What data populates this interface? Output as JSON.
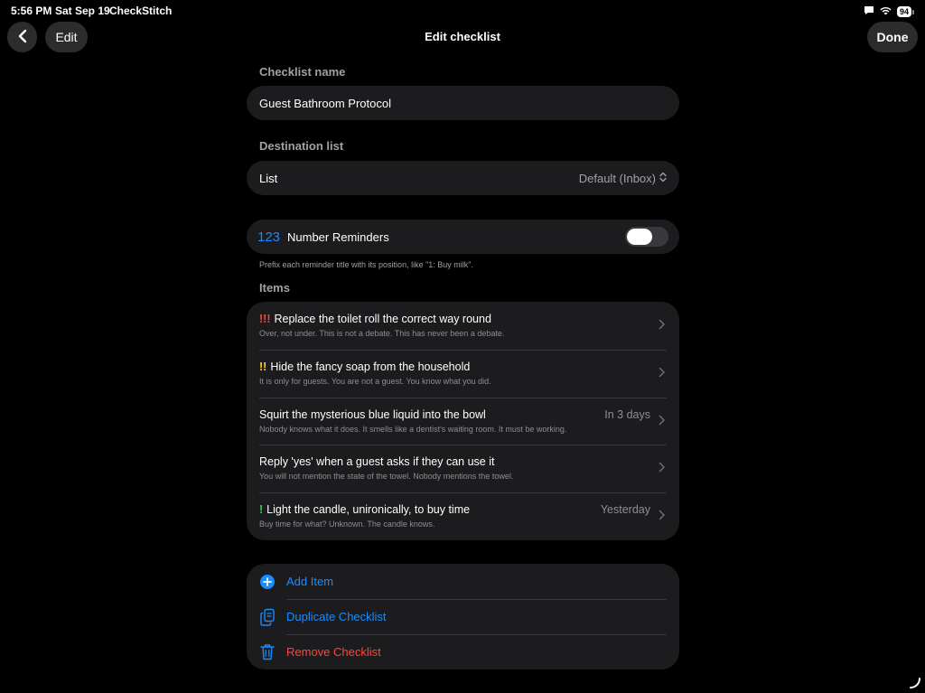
{
  "status_bar": {
    "time": "5:56 PM",
    "date": "Sat Sep 19",
    "app": "CheckStitch",
    "battery": "94"
  },
  "nav": {
    "back_icon": "chevron-left-icon",
    "edit_label": "Edit",
    "title": "Edit checklist",
    "done_label": "Done"
  },
  "checklist_name": {
    "label": "Checklist name",
    "value": "Guest Bathroom Protocol"
  },
  "destination": {
    "label": "Destination list",
    "field_label": "List",
    "value": "Default (Inbox)"
  },
  "number_reminders": {
    "icon_text": "123",
    "label": "Number Reminders",
    "enabled": false,
    "note": "Prefix each reminder title with its position, like \"1: Buy milk\"."
  },
  "items": {
    "label": "Items",
    "list": [
      {
        "priority": "!!!",
        "title": "Replace the toilet roll the correct way round",
        "note": "Over, not under. This is not a debate. This has never been a debate.",
        "due": ""
      },
      {
        "priority": "!!",
        "title": "Hide the fancy soap from the household",
        "note": "It is only for guests. You are not a guest. You know what you did.",
        "due": ""
      },
      {
        "priority": "",
        "title": "Squirt the mysterious blue liquid into the bowl",
        "note": "Nobody knows what it does. It smells like a dentist's waiting room. It must be working.",
        "due": "In 3 days"
      },
      {
        "priority": "",
        "title": "Reply 'yes' when a guest asks if they can use it",
        "note": "You will not mention the state of the towel. Nobody mentions the towel.",
        "due": ""
      },
      {
        "priority": "!",
        "title": "Light the candle, unironically, to buy time",
        "note": "Buy time for what? Unknown. The candle knows.",
        "due": "Yesterday"
      }
    ]
  },
  "actions": {
    "add_item": "Add Item",
    "duplicate": "Duplicate Checklist",
    "remove": "Remove Checklist"
  },
  "colors": {
    "accent": "#1a8cff",
    "destructive": "#ff453a",
    "priority_high": "#ff453a",
    "priority_medium": "#ffd60a",
    "priority_low": "#30d158"
  }
}
